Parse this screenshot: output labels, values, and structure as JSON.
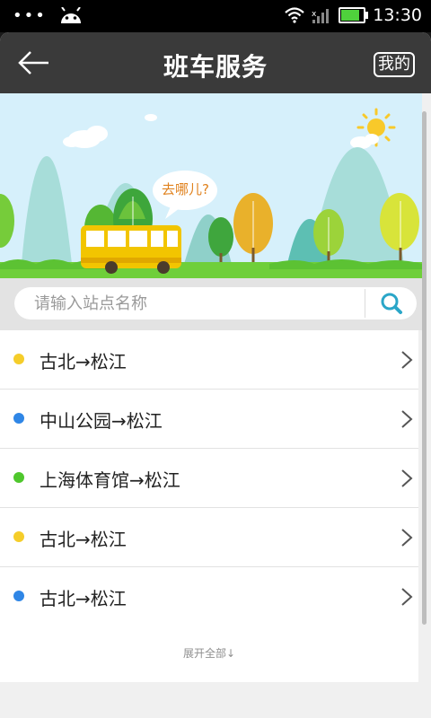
{
  "status_bar": {
    "time": "13:30",
    "overflow_dots": "•••"
  },
  "title_bar": {
    "title": "班车服务",
    "mine_label": "我的"
  },
  "banner": {
    "bubble_text": "去哪儿?"
  },
  "search": {
    "placeholder": "请输入站点名称",
    "value": ""
  },
  "routes": [
    {
      "label": "古北→松江",
      "dot_color": "#f5cd2a"
    },
    {
      "label": "中山公园→松江",
      "dot_color": "#2f86e6"
    },
    {
      "label": "上海体育馆→松江",
      "dot_color": "#4fc72d"
    },
    {
      "label": "古北→松江",
      "dot_color": "#f5cd2a"
    },
    {
      "label": "古北→松江",
      "dot_color": "#2f86e6"
    }
  ],
  "expand_label": "展开全部↓",
  "colors": {
    "title_bar": "#3a3a3a",
    "accent": "#2aa6c8",
    "grass": "#6fcf3a",
    "bus": "#f2c500"
  }
}
